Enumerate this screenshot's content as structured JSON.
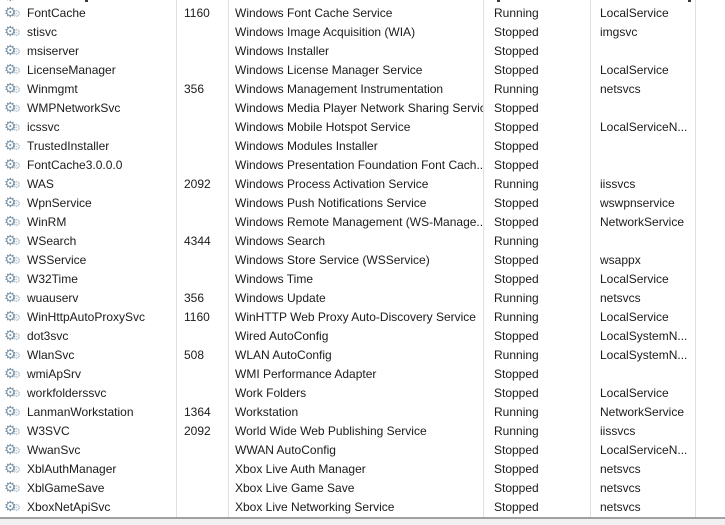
{
  "colors": {
    "text": "#1b1b1b",
    "gridline": "#e0e0e0",
    "bottom_border": "#9fa1a3",
    "gear_main": "#7d95a9",
    "gear_secondary": "#b7c7d3"
  },
  "icons": {
    "row_icon": "gear-icon"
  },
  "table": {
    "rows": [
      {
        "name": "FontCache",
        "pid": "1160",
        "description": "Windows Font Cache Service",
        "status": "Running",
        "group": "LocalService"
      },
      {
        "name": "stisvc",
        "pid": "",
        "description": "Windows Image Acquisition (WIA)",
        "status": "Stopped",
        "group": "imgsvc"
      },
      {
        "name": "msiserver",
        "pid": "",
        "description": "Windows Installer",
        "status": "Stopped",
        "group": ""
      },
      {
        "name": "LicenseManager",
        "pid": "",
        "description": "Windows License Manager Service",
        "status": "Stopped",
        "group": "LocalService"
      },
      {
        "name": "Winmgmt",
        "pid": "356",
        "description": "Windows Management Instrumentation",
        "status": "Running",
        "group": "netsvcs"
      },
      {
        "name": "WMPNetworkSvc",
        "pid": "",
        "description": "Windows Media Player Network Sharing Service",
        "status": "Stopped",
        "group": ""
      },
      {
        "name": "icssvc",
        "pid": "",
        "description": "Windows Mobile Hotspot Service",
        "status": "Stopped",
        "group": "LocalServiceN..."
      },
      {
        "name": "TrustedInstaller",
        "pid": "",
        "description": "Windows Modules Installer",
        "status": "Stopped",
        "group": ""
      },
      {
        "name": "FontCache3.0.0.0",
        "pid": "",
        "description": "Windows Presentation Foundation Font Cach...",
        "status": "Stopped",
        "group": ""
      },
      {
        "name": "WAS",
        "pid": "2092",
        "description": "Windows Process Activation Service",
        "status": "Running",
        "group": "iissvcs"
      },
      {
        "name": "WpnService",
        "pid": "",
        "description": "Windows Push Notifications Service",
        "status": "Stopped",
        "group": "wswpnservice"
      },
      {
        "name": "WinRM",
        "pid": "",
        "description": "Windows Remote Management (WS-Manage...",
        "status": "Stopped",
        "group": "NetworkService"
      },
      {
        "name": "WSearch",
        "pid": "4344",
        "description": "Windows Search",
        "status": "Running",
        "group": ""
      },
      {
        "name": "WSService",
        "pid": "",
        "description": "Windows Store Service (WSService)",
        "status": "Stopped",
        "group": "wsappx"
      },
      {
        "name": "W32Time",
        "pid": "",
        "description": "Windows Time",
        "status": "Stopped",
        "group": "LocalService"
      },
      {
        "name": "wuauserv",
        "pid": "356",
        "description": "Windows Update",
        "status": "Running",
        "group": "netsvcs"
      },
      {
        "name": "WinHttpAutoProxySvc",
        "pid": "1160",
        "description": "WinHTTP Web Proxy Auto-Discovery Service",
        "status": "Running",
        "group": "LocalService"
      },
      {
        "name": "dot3svc",
        "pid": "",
        "description": "Wired AutoConfig",
        "status": "Stopped",
        "group": "LocalSystemN..."
      },
      {
        "name": "WlanSvc",
        "pid": "508",
        "description": "WLAN AutoConfig",
        "status": "Running",
        "group": "LocalSystemN..."
      },
      {
        "name": "wmiApSrv",
        "pid": "",
        "description": "WMI Performance Adapter",
        "status": "Stopped",
        "group": ""
      },
      {
        "name": "workfolderssvc",
        "pid": "",
        "description": "Work Folders",
        "status": "Stopped",
        "group": "LocalService"
      },
      {
        "name": "LanmanWorkstation",
        "pid": "1364",
        "description": "Workstation",
        "status": "Running",
        "group": "NetworkService"
      },
      {
        "name": "W3SVC",
        "pid": "2092",
        "description": "World Wide Web Publishing Service",
        "status": "Running",
        "group": "iissvcs"
      },
      {
        "name": "WwanSvc",
        "pid": "",
        "description": "WWAN AutoConfig",
        "status": "Stopped",
        "group": "LocalServiceN..."
      },
      {
        "name": "XblAuthManager",
        "pid": "",
        "description": "Xbox Live Auth Manager",
        "status": "Stopped",
        "group": "netsvcs"
      },
      {
        "name": "XblGameSave",
        "pid": "",
        "description": "Xbox Live Game Save",
        "status": "Stopped",
        "group": "netsvcs"
      },
      {
        "name": "XboxNetApiSvc",
        "pid": "",
        "description": "Xbox Live Networking Service",
        "status": "Stopped",
        "group": "netsvcs"
      }
    ]
  }
}
